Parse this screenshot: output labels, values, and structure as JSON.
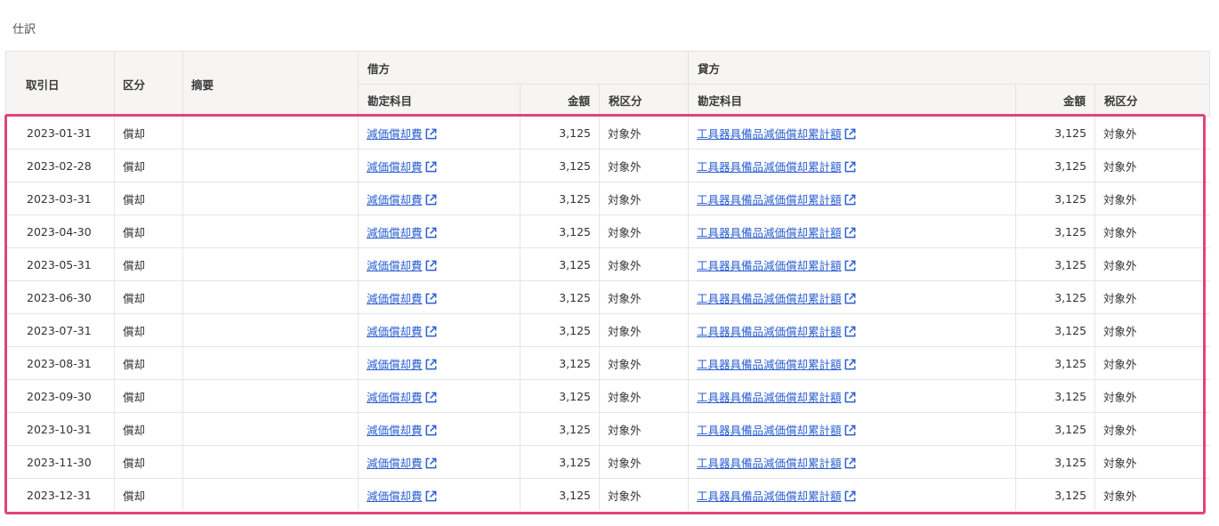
{
  "section": {
    "title": "仕訳"
  },
  "table": {
    "headers": {
      "date": "取引日",
      "category": "区分",
      "memo": "摘要",
      "debit_group": "借方",
      "credit_group": "貸方",
      "debit_account": "勘定科目",
      "debit_amount": "金額",
      "debit_tax": "税区分",
      "credit_account": "勘定科目",
      "credit_amount": "金額",
      "credit_tax": "税区分"
    },
    "rows": [
      {
        "date": "2023-01-31",
        "category": "償却",
        "memo": "",
        "debit_account": "減価償却費",
        "debit_amount": "3,125",
        "debit_tax": "対象外",
        "credit_account": "工具器具備品減価償却累計額",
        "credit_amount": "3,125",
        "credit_tax": "対象外"
      },
      {
        "date": "2023-02-28",
        "category": "償却",
        "memo": "",
        "debit_account": "減価償却費",
        "debit_amount": "3,125",
        "debit_tax": "対象外",
        "credit_account": "工具器具備品減価償却累計額",
        "credit_amount": "3,125",
        "credit_tax": "対象外"
      },
      {
        "date": "2023-03-31",
        "category": "償却",
        "memo": "",
        "debit_account": "減価償却費",
        "debit_amount": "3,125",
        "debit_tax": "対象外",
        "credit_account": "工具器具備品減価償却累計額",
        "credit_amount": "3,125",
        "credit_tax": "対象外"
      },
      {
        "date": "2023-04-30",
        "category": "償却",
        "memo": "",
        "debit_account": "減価償却費",
        "debit_amount": "3,125",
        "debit_tax": "対象外",
        "credit_account": "工具器具備品減価償却累計額",
        "credit_amount": "3,125",
        "credit_tax": "対象外"
      },
      {
        "date": "2023-05-31",
        "category": "償却",
        "memo": "",
        "debit_account": "減価償却費",
        "debit_amount": "3,125",
        "debit_tax": "対象外",
        "credit_account": "工具器具備品減価償却累計額",
        "credit_amount": "3,125",
        "credit_tax": "対象外"
      },
      {
        "date": "2023-06-30",
        "category": "償却",
        "memo": "",
        "debit_account": "減価償却費",
        "debit_amount": "3,125",
        "debit_tax": "対象外",
        "credit_account": "工具器具備品減価償却累計額",
        "credit_amount": "3,125",
        "credit_tax": "対象外"
      },
      {
        "date": "2023-07-31",
        "category": "償却",
        "memo": "",
        "debit_account": "減価償却費",
        "debit_amount": "3,125",
        "debit_tax": "対象外",
        "credit_account": "工具器具備品減価償却累計額",
        "credit_amount": "3,125",
        "credit_tax": "対象外"
      },
      {
        "date": "2023-08-31",
        "category": "償却",
        "memo": "",
        "debit_account": "減価償却費",
        "debit_amount": "3,125",
        "debit_tax": "対象外",
        "credit_account": "工具器具備品減価償却累計額",
        "credit_amount": "3,125",
        "credit_tax": "対象外"
      },
      {
        "date": "2023-09-30",
        "category": "償却",
        "memo": "",
        "debit_account": "減価償却費",
        "debit_amount": "3,125",
        "debit_tax": "対象外",
        "credit_account": "工具器具備品減価償却累計額",
        "credit_amount": "3,125",
        "credit_tax": "対象外"
      },
      {
        "date": "2023-10-31",
        "category": "償却",
        "memo": "",
        "debit_account": "減価償却費",
        "debit_amount": "3,125",
        "debit_tax": "対象外",
        "credit_account": "工具器具備品減価償却累計額",
        "credit_amount": "3,125",
        "credit_tax": "対象外"
      },
      {
        "date": "2023-11-30",
        "category": "償却",
        "memo": "",
        "debit_account": "減価償却費",
        "debit_amount": "3,125",
        "debit_tax": "対象外",
        "credit_account": "工具器具備品減価償却累計額",
        "credit_amount": "3,125",
        "credit_tax": "対象外"
      },
      {
        "date": "2023-12-31",
        "category": "償却",
        "memo": "",
        "debit_account": "減価償却費",
        "debit_amount": "3,125",
        "debit_tax": "対象外",
        "credit_account": "工具器具備品減価償却累計額",
        "credit_amount": "3,125",
        "credit_tax": "対象外"
      }
    ]
  },
  "icons": {
    "account_link": "external-link-icon"
  },
  "colors": {
    "link": "#2c5fd1",
    "highlight": "#e0457b",
    "header_bg": "#f6f5f4"
  }
}
